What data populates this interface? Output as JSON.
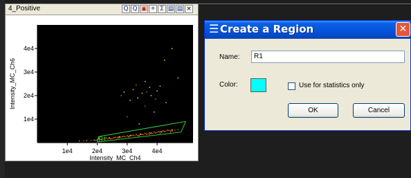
{
  "plot_window": {
    "title": "4_Positive",
    "toolbar_icons": [
      "zoom-in-icon",
      "zoom-out-icon",
      "region-icon",
      "crosshair-icon",
      "sigma-icon",
      "restore-icon",
      "maximize-icon",
      "close-icon"
    ],
    "toolbar_glyphs": [
      "Q",
      "Q",
      "▣",
      "⌖",
      "Σ",
      "▤",
      "▤",
      "×"
    ]
  },
  "chart_data": {
    "type": "scatter",
    "xlabel": "Intensity_MC_Ch4",
    "ylabel": "Intensity_MC_Ch6",
    "xlim": [
      0,
      52000
    ],
    "ylim": [
      0,
      50000
    ],
    "x_ticks": [
      {
        "value": 10000,
        "label": "1e4"
      },
      {
        "value": 20000,
        "label": "2e4"
      },
      {
        "value": 30000,
        "label": "3e4"
      },
      {
        "value": 40000,
        "label": "4e4"
      }
    ],
    "y_ticks": [
      {
        "value": 10000,
        "label": "1e4"
      },
      {
        "value": 20000,
        "label": "2e4"
      },
      {
        "value": 30000,
        "label": "3e4"
      },
      {
        "value": 40000,
        "label": "4e4"
      }
    ],
    "grid": false,
    "background": "#000000",
    "region": {
      "name": "R1",
      "color": "#33cc33",
      "polygon": [
        [
          20000,
          300
        ],
        [
          48000,
          4500
        ],
        [
          49500,
          9000
        ],
        [
          20500,
          2600
        ]
      ]
    },
    "series": [
      {
        "color": "#ff8c1a",
        "points": [
          [
            14000,
            700
          ],
          [
            16500,
            900
          ],
          [
            19000,
            1100
          ],
          [
            21000,
            1400
          ],
          [
            22500,
            1600
          ],
          [
            24000,
            1900
          ],
          [
            25500,
            2100
          ],
          [
            27000,
            2400
          ],
          [
            28500,
            2600
          ],
          [
            30000,
            2900
          ],
          [
            31500,
            3100
          ],
          [
            33000,
            3400
          ],
          [
            34500,
            3700
          ],
          [
            36000,
            3900
          ],
          [
            37500,
            4200
          ],
          [
            39000,
            4500
          ],
          [
            40500,
            4700
          ],
          [
            42000,
            5000
          ],
          [
            43500,
            5300
          ],
          [
            45000,
            5600
          ],
          [
            23000,
            2000
          ],
          [
            26000,
            2300
          ],
          [
            29000,
            2700
          ],
          [
            32000,
            3200
          ],
          [
            35000,
            3500
          ],
          [
            38000,
            4000
          ],
          [
            41000,
            4600
          ],
          [
            44000,
            5200
          ],
          [
            20000,
            1200
          ],
          [
            24500,
            1700
          ],
          [
            27500,
            2200
          ],
          [
            30500,
            2700
          ],
          [
            33500,
            3000
          ],
          [
            36500,
            3600
          ],
          [
            39500,
            4100
          ],
          [
            42500,
            4800
          ]
        ]
      },
      {
        "color": "#ff3030",
        "points": [
          [
            18000,
            900
          ],
          [
            21500,
            1300
          ],
          [
            25000,
            1800
          ],
          [
            28000,
            2300
          ],
          [
            31000,
            2800
          ],
          [
            34000,
            3300
          ],
          [
            37000,
            3800
          ],
          [
            40000,
            4300
          ],
          [
            43000,
            4900
          ],
          [
            46000,
            5400
          ],
          [
            22000,
            1500
          ],
          [
            26500,
            2000
          ],
          [
            29500,
            2500
          ],
          [
            32500,
            2900
          ],
          [
            35500,
            3400
          ],
          [
            38500,
            3900
          ],
          [
            41500,
            4500
          ],
          [
            44500,
            5100
          ]
        ]
      },
      {
        "color": "#ffd23a",
        "points": [
          [
            20500,
            1700
          ],
          [
            24000,
            2100
          ],
          [
            27500,
            2600
          ],
          [
            31000,
            3100
          ],
          [
            34500,
            3500
          ],
          [
            38000,
            4100
          ],
          [
            41500,
            4600
          ],
          [
            45000,
            5100
          ],
          [
            29000,
            21500
          ],
          [
            32000,
            22500
          ],
          [
            35000,
            21000
          ],
          [
            37500,
            23500
          ],
          [
            40000,
            22000
          ],
          [
            33500,
            19000
          ],
          [
            38000,
            20000
          ],
          [
            41000,
            24000
          ],
          [
            36000,
            26000
          ],
          [
            43000,
            17000
          ],
          [
            31000,
            18000
          ],
          [
            39000,
            13000
          ],
          [
            34000,
            8000
          ],
          [
            45000,
            40000
          ],
          [
            42500,
            35000
          ],
          [
            47000,
            27500
          ]
        ]
      },
      {
        "color": "#c86414",
        "points": [
          [
            15500,
            800
          ],
          [
            19500,
            1000
          ],
          [
            23500,
            1500
          ],
          [
            27000,
            2000
          ],
          [
            30500,
            2500
          ],
          [
            34000,
            3000
          ],
          [
            37500,
            3500
          ],
          [
            41000,
            4000
          ],
          [
            44500,
            4600
          ],
          [
            47000,
            5500
          ],
          [
            28000,
            20000
          ],
          [
            36500,
            21500
          ],
          [
            39500,
            18500
          ],
          [
            33000,
            24500
          ],
          [
            30000,
            11000
          ],
          [
            36000,
            15500
          ]
        ]
      }
    ]
  },
  "dialog": {
    "icon_glyph": "☰",
    "title": "Create a Region",
    "close_glyph": "✕",
    "name_label": "Name:",
    "name_value": "R1",
    "color_label": "Color:",
    "color_value": "#00ffff",
    "stats_label": "Use for statistics only",
    "stats_checked": false,
    "ok_label": "OK",
    "cancel_label": "Cancel"
  }
}
